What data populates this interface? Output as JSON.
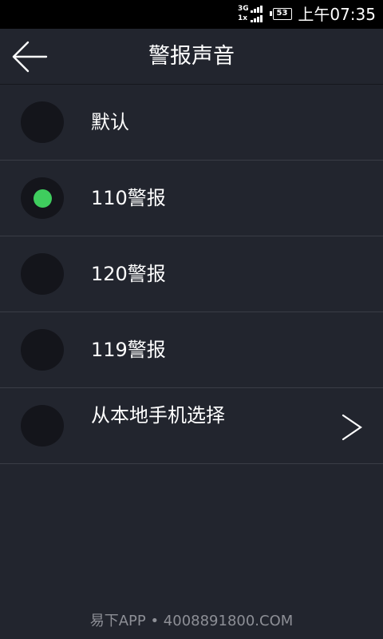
{
  "status_bar": {
    "network_primary": "3G",
    "network_secondary": "1x",
    "battery": "53",
    "time": "上午07:35"
  },
  "header": {
    "title": "警报声音",
    "back_icon": "arrow-left-icon"
  },
  "options": [
    {
      "label": "默认",
      "selected": false
    },
    {
      "label": "110警报",
      "selected": true
    },
    {
      "label": "120警报",
      "selected": false
    },
    {
      "label": "119警报",
      "selected": false
    },
    {
      "label": "从本地手机选择",
      "selected": false,
      "icon": "chevron-right-icon"
    }
  ],
  "footer": {
    "watermark": "易下APP • 4008891800.COM"
  },
  "colors": {
    "background": "#22252e",
    "status_bar": "#000000",
    "radio_off": "#14151b",
    "radio_on": "#3fcd5e",
    "divider": "#3a3d46"
  }
}
